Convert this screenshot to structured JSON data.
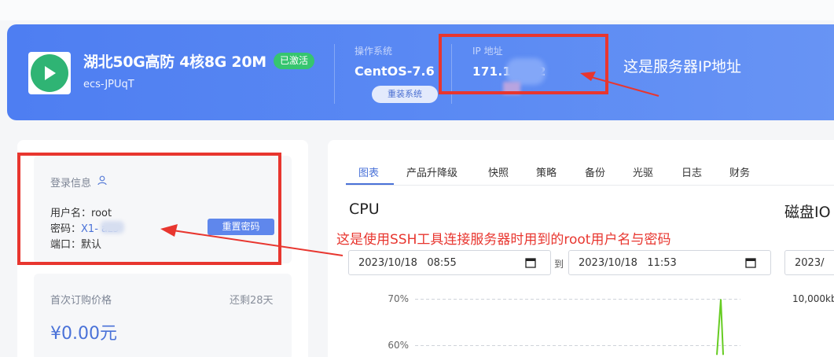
{
  "server": {
    "name": "湖北50G高防 4核8G 20M",
    "status_badge": "已激活",
    "instance_id": "ecs-JPUqT",
    "os_label": "操作系统",
    "os_value": "CentOS-7.6",
    "reinstall_button": "重装系统",
    "ip_label": "IP 地址",
    "ip_value": "171.1     0.42"
  },
  "annotations": {
    "ip_note": "这是服务器IP地址",
    "ssh_note": "这是使用SSH工具连接服务器时用到的root用户名与密码"
  },
  "login": {
    "title": "登录信息",
    "username_label": "用户名：",
    "username_value": "root",
    "password_label": "密码：",
    "password_value": "X1-      azs",
    "port_label": "端口：",
    "port_value": "默认",
    "reset_button": "重置密码"
  },
  "price": {
    "label": "首次订购价格",
    "remaining": "还剩28天",
    "value": "¥0.00元"
  },
  "tabs": [
    "图表",
    "产品升降级",
    "快照",
    "策略",
    "备份",
    "光驱",
    "日志",
    "财务"
  ],
  "charts": {
    "cpu_title": "CPU",
    "disk_title": "磁盘IO",
    "date_from": "2023/10/18   08:55",
    "to_label": "到",
    "date_to": "2023/10/18   11:53",
    "date_extra": "2023/",
    "disk_tick": "10,000kb"
  },
  "chart_data": {
    "type": "line",
    "title": "CPU",
    "ylabel": "",
    "yticks": [
      "70%",
      "60%"
    ],
    "ylim": [
      55,
      72
    ],
    "series": [
      {
        "values": [
          {
            "x": "2023/10/18 11:50",
            "y": 58
          },
          {
            "x": "2023/10/18 11:51",
            "y": 70
          },
          {
            "x": "2023/10/18 11:52",
            "y": 58
          }
        ]
      }
    ]
  },
  "colors": {
    "banner": "#5080f2",
    "accent": "#4a72d8",
    "badge": "#36c56f",
    "annotation": "#e8362f",
    "chart_line": "#66cc22"
  },
  "icons": {
    "app": "play-icon",
    "login": "user-icon",
    "calendar": "calendar-icon"
  }
}
